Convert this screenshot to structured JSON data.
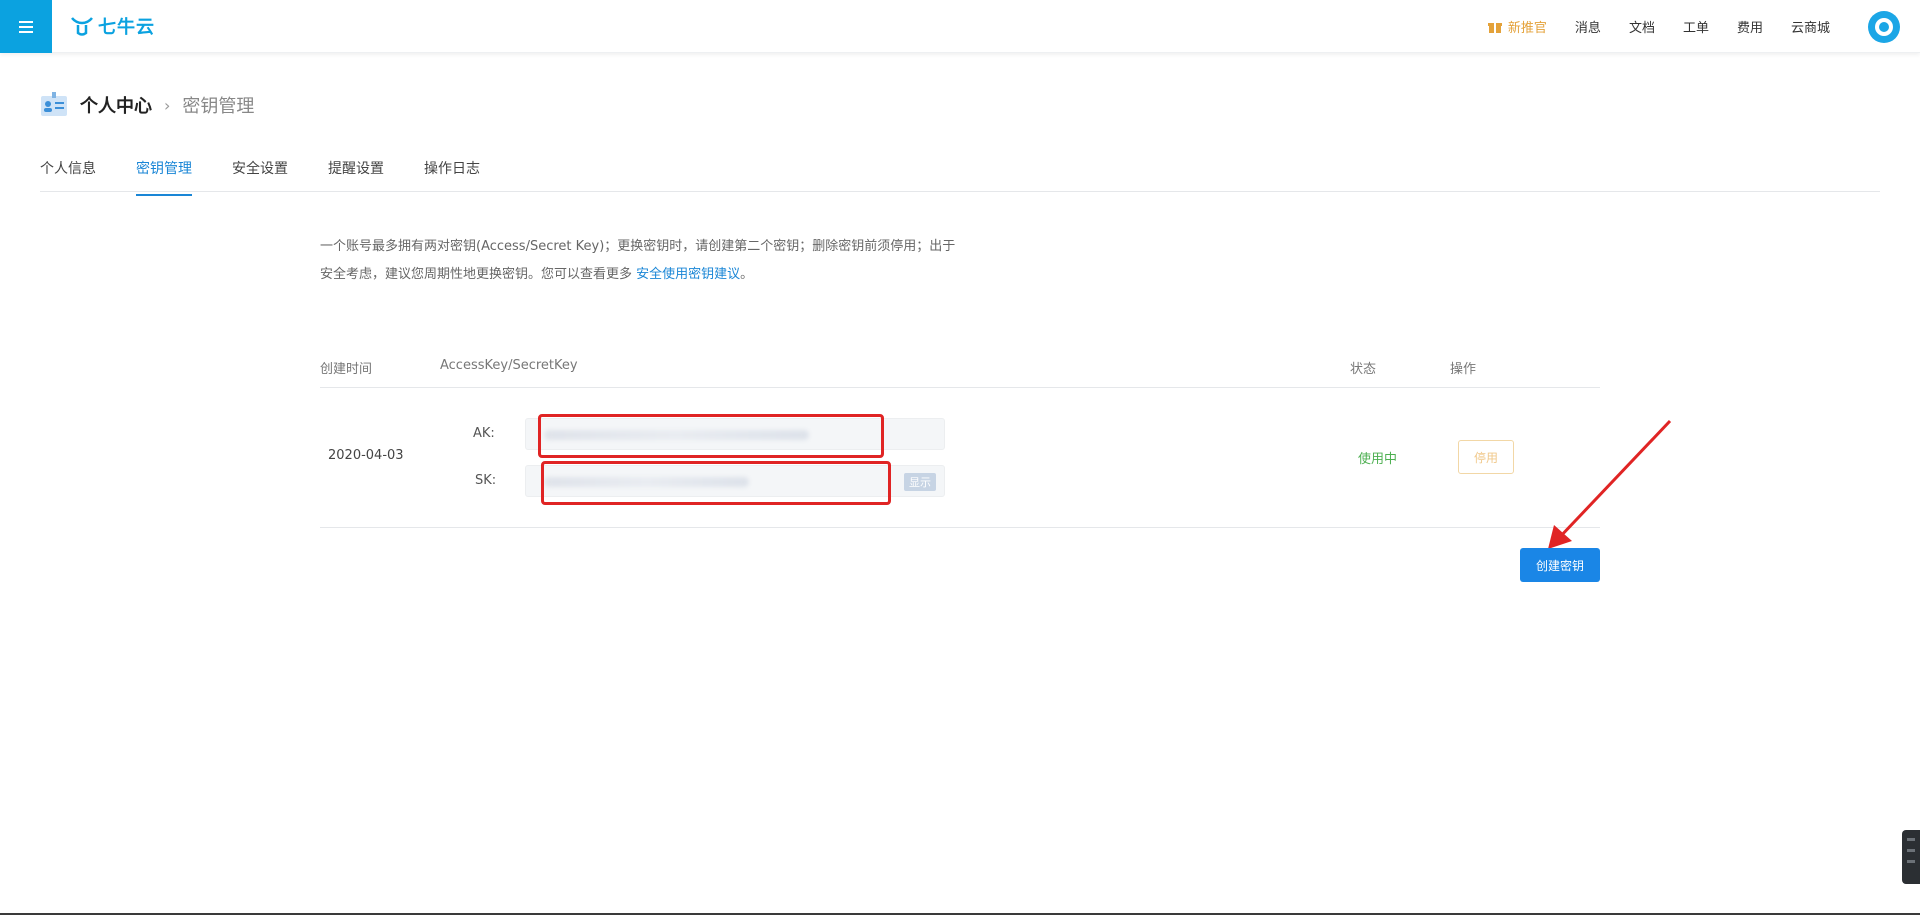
{
  "header": {
    "logo_text": "七牛云",
    "promo_label": "新推官",
    "nav": [
      "消息",
      "文档",
      "工单",
      "费用",
      "云商城"
    ]
  },
  "breadcrumb": {
    "parent": "个人中心",
    "current": "密钥管理"
  },
  "tabs": [
    "个人信息",
    "密钥管理",
    "安全设置",
    "提醒设置",
    "操作日志"
  ],
  "active_tab": "密钥管理",
  "description": {
    "text_part1": "一个账号最多拥有两对密钥(Access/Secret Key)；更换密钥时，请创建第二个密钥；删除密钥前须停用；出于安全考虑，建议您周期性地更换密钥。您可以查看更多 ",
    "link": "安全使用密钥建议",
    "text_part2": "。"
  },
  "table": {
    "headers": {
      "created": "创建时间",
      "keys": "AccessKey/SecretKey",
      "status": "状态",
      "actions": "操作"
    },
    "rows": [
      {
        "created": "2020-04-03",
        "ak_label": "AK:",
        "sk_label": "SK:",
        "show_label": "显示",
        "status": "使用中",
        "action": "停用"
      }
    ]
  },
  "create_button": "创建密钥",
  "colors": {
    "brand": "#0ba2e0",
    "link": "#1a86d6",
    "status_active": "#4caf50",
    "annotation": "#e02424"
  }
}
